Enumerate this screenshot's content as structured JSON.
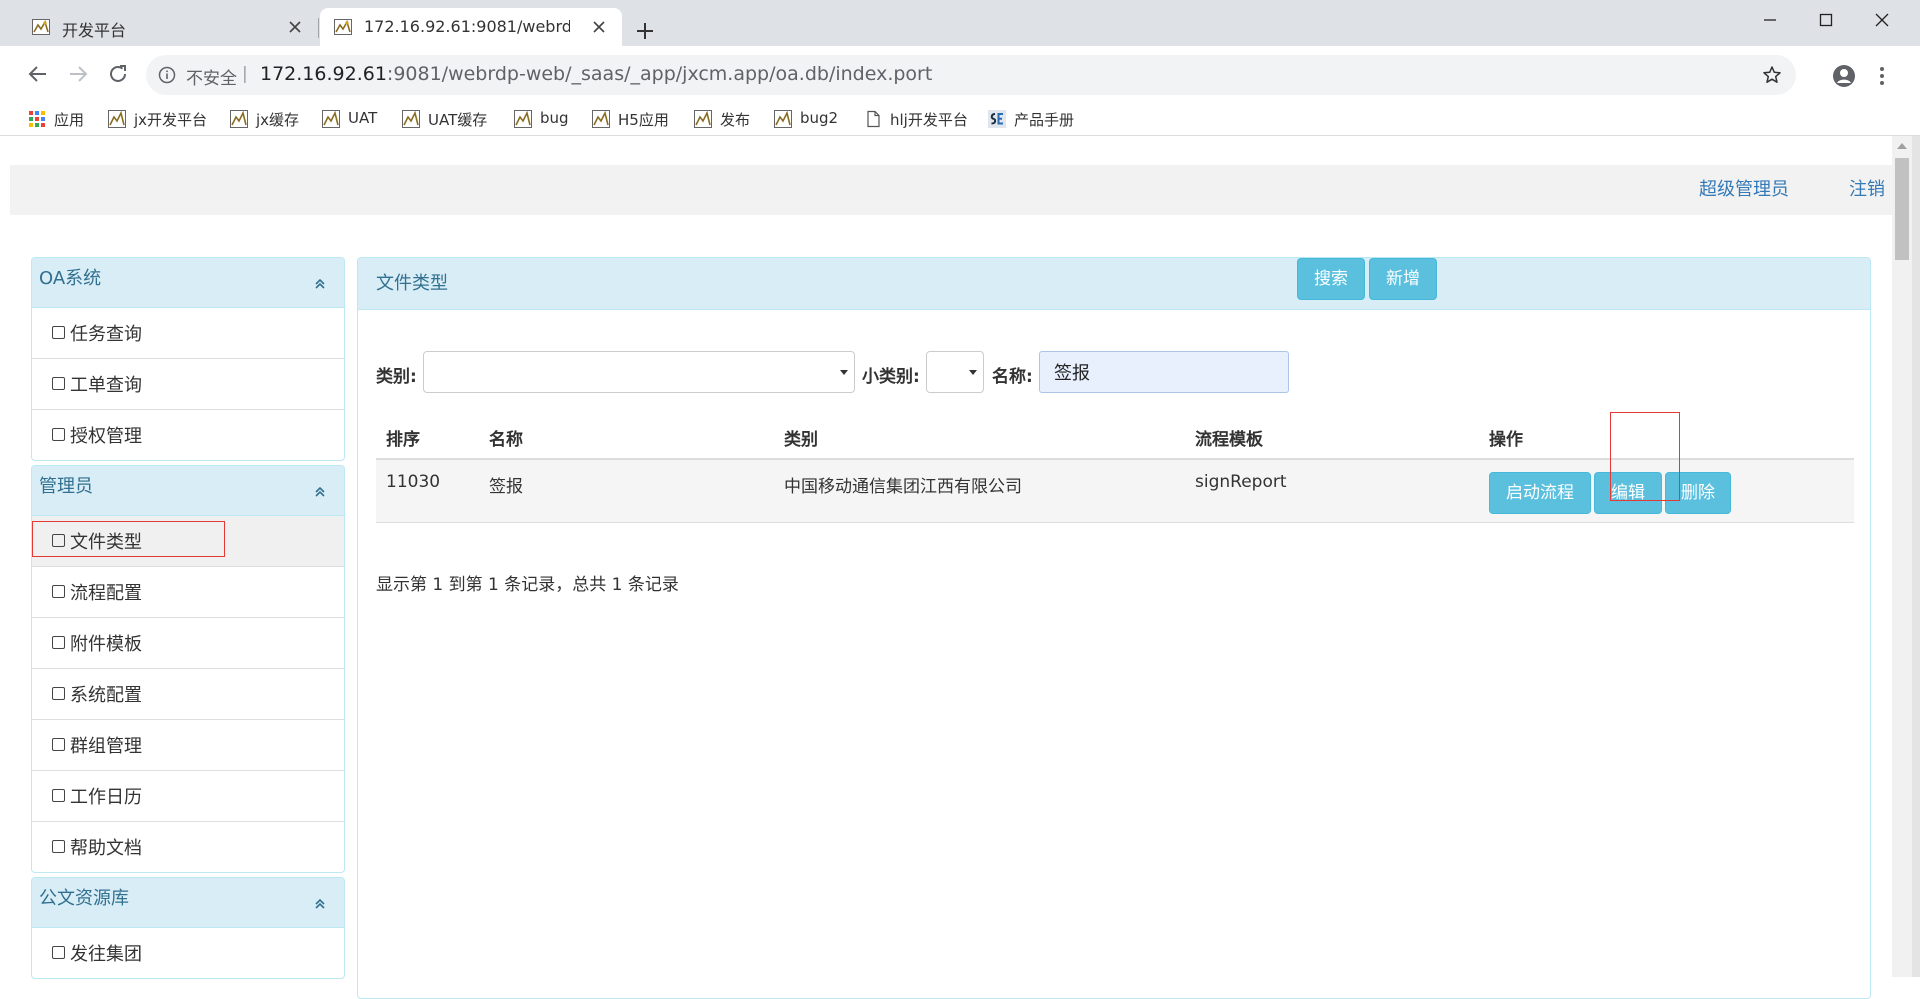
{
  "browser": {
    "tabs": [
      {
        "title": "开发平台",
        "active": false
      },
      {
        "title": "172.16.92.61:9081/webrdp-web/_saas/_app/jxcm.app/oa.db/index.port",
        "active": true
      }
    ],
    "address": {
      "security_label": "不安全",
      "host": "172.16.92.61",
      "path": ":9081/webrdp-web/_saas/_app/jxcm.app/oa.db/index.port"
    },
    "bookmarks": [
      {
        "label": "应用",
        "icon": "apps-grid-icon"
      },
      {
        "label": "jx开发平台",
        "icon": "bookmark-favicon-icon"
      },
      {
        "label": "jx缓存",
        "icon": "bookmark-favicon-icon"
      },
      {
        "label": "UAT",
        "icon": "bookmark-favicon-icon"
      },
      {
        "label": "UAT缓存",
        "icon": "bookmark-favicon-icon"
      },
      {
        "label": "bug",
        "icon": "bookmark-favicon-icon"
      },
      {
        "label": "H5应用",
        "icon": "bookmark-favicon-icon"
      },
      {
        "label": "发布",
        "icon": "bookmark-favicon-icon"
      },
      {
        "label": "bug2",
        "icon": "bookmark-favicon-icon"
      },
      {
        "label": "hlj开发平台",
        "icon": "page-icon"
      },
      {
        "label": "产品手册",
        "icon": "se-logo-icon"
      }
    ]
  },
  "header": {
    "user": "超级管理员",
    "logout": "注销"
  },
  "sidebar": {
    "groups": [
      {
        "title": "OA系统",
        "items": [
          "任务查询",
          "工单查询",
          "授权管理"
        ]
      },
      {
        "title": "管理员",
        "items": [
          "文件类型",
          "流程配置",
          "附件模板",
          "系统配置",
          "群组管理",
          "工作日历",
          "帮助文档"
        ]
      },
      {
        "title": "公文资源库",
        "items": [
          "发往集团"
        ]
      }
    ],
    "selected": "文件类型"
  },
  "main": {
    "title": "文件类型",
    "filters": {
      "category_label": "类别:",
      "category_value": "",
      "subcategory_label": "小类别:",
      "subcategory_value": "",
      "name_label": "名称:",
      "name_value": "签报"
    },
    "buttons": {
      "search": "搜索",
      "add": "新增"
    },
    "table": {
      "columns": [
        "排序",
        "名称",
        "类别",
        "流程模板",
        "操作"
      ],
      "rows": [
        {
          "order": "11030",
          "name": "签报",
          "category": "中国移动通信集团江西有限公司",
          "template": "signReport",
          "actions": [
            "启动流程",
            "编辑",
            "删除"
          ]
        }
      ]
    },
    "pagination": "显示第 1 到第 1 条记录，总共 1 条记录"
  },
  "colors": {
    "accent": "#5bc0de",
    "panel_heading_bg": "#d9edf7",
    "panel_title": "#31708f",
    "link": "#337ab7",
    "highlight_box": "#e53935"
  }
}
